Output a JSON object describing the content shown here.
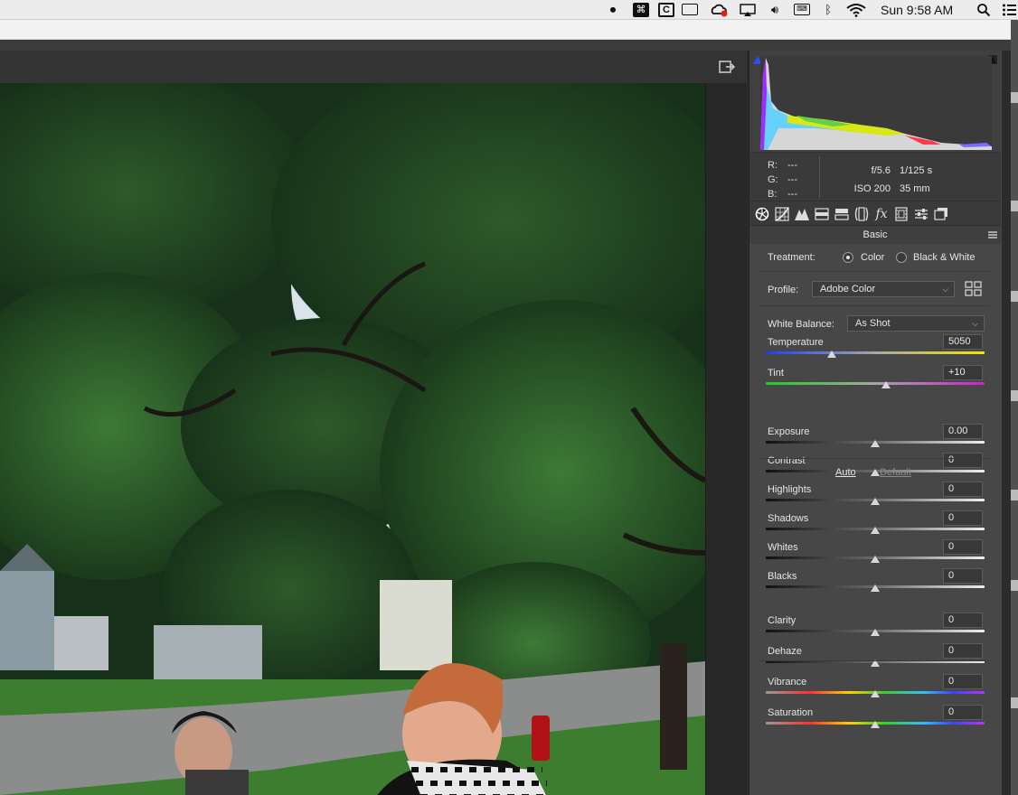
{
  "menubar": {
    "clock": "Sun 9:58 AM",
    "icons": [
      "record-icon",
      "command-icon",
      "c-app-icon",
      "display-icon",
      "creative-cloud-icon",
      "airplay-icon",
      "volume-icon",
      "keyboard-input-icon",
      "bluetooth-icon",
      "wifi-icon",
      "spotlight-search-icon",
      "notification-center-icon"
    ]
  },
  "histogram": {
    "rgb_labels": [
      "R:",
      "G:",
      "B:"
    ],
    "rgb_values": [
      "---",
      "---",
      "---"
    ],
    "aperture": "f/5.6",
    "shutter": "1/125 s",
    "iso": "ISO 200",
    "focal_length": "35 mm"
  },
  "tabs": [
    "basic-tab-icon",
    "tone-curve-tab-icon",
    "detail-tab-icon",
    "hsl-tab-icon",
    "split-toning-tab-icon",
    "lens-corrections-tab-icon",
    "effects-tab-icon",
    "camera-calibration-tab-icon",
    "presets-tab-icon",
    "snapshots-tab-icon"
  ],
  "basic": {
    "title": "Basic",
    "treatment_label": "Treatment:",
    "treatment_options": [
      "Color",
      "Black & White"
    ],
    "treatment_selected": "Color",
    "profile_label": "Profile:",
    "profile_value": "Adobe Color",
    "wb_label": "White Balance:",
    "wb_value": "As Shot",
    "auto_label": "Auto",
    "default_label": "Default",
    "sliders": [
      {
        "label": "Temperature",
        "value": "5050",
        "position": 0.3,
        "gradient": "temp"
      },
      {
        "label": "Tint",
        "value": "+10",
        "position": 0.55,
        "gradient": "tint"
      },
      {
        "label": "Exposure",
        "value": "0.00",
        "position": 0.5,
        "gradient": "gray"
      },
      {
        "label": "Contrast",
        "value": "0",
        "position": 0.5,
        "gradient": "gray"
      },
      {
        "label": "Highlights",
        "value": "0",
        "position": 0.5,
        "gradient": "gray"
      },
      {
        "label": "Shadows",
        "value": "0",
        "position": 0.5,
        "gradient": "gray"
      },
      {
        "label": "Whites",
        "value": "0",
        "position": 0.5,
        "gradient": "gray"
      },
      {
        "label": "Blacks",
        "value": "0",
        "position": 0.5,
        "gradient": "gray"
      },
      {
        "label": "Clarity",
        "value": "0",
        "position": 0.5,
        "gradient": "gray"
      },
      {
        "label": "Dehaze",
        "value": "0",
        "position": 0.5,
        "gradient": "gray"
      },
      {
        "label": "Vibrance",
        "value": "0",
        "position": 0.5,
        "gradient": "rainbow"
      },
      {
        "label": "Saturation",
        "value": "0",
        "position": 0.5,
        "gradient": "rainbow"
      }
    ]
  },
  "colors": {
    "panel_bg": "#474747",
    "accent_blue": "#2a4dff",
    "foliage": "#1f3d1d"
  }
}
